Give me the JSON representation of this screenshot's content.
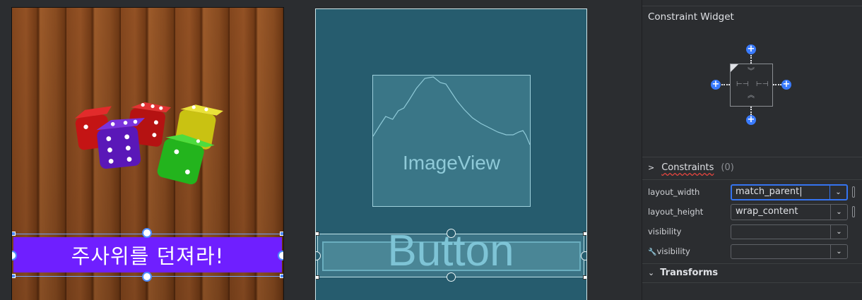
{
  "design": {
    "button_text": "주사위를 던져라!",
    "button_color": "#6f1fff"
  },
  "blueprint": {
    "image_label": "ImageView",
    "button_label": "Button",
    "background_color": "#265c6e"
  },
  "panel": {
    "section_title": "Constraint Widget",
    "constraints": {
      "label": "Constraints",
      "count": "(0)"
    },
    "attributes": [
      {
        "name": "layout_width",
        "value": "match_parent"
      },
      {
        "name": "layout_height",
        "value": "wrap_content"
      },
      {
        "name": "visibility",
        "value": ""
      },
      {
        "name": "visibility",
        "value": ""
      }
    ],
    "transforms_label": "Transforms"
  }
}
